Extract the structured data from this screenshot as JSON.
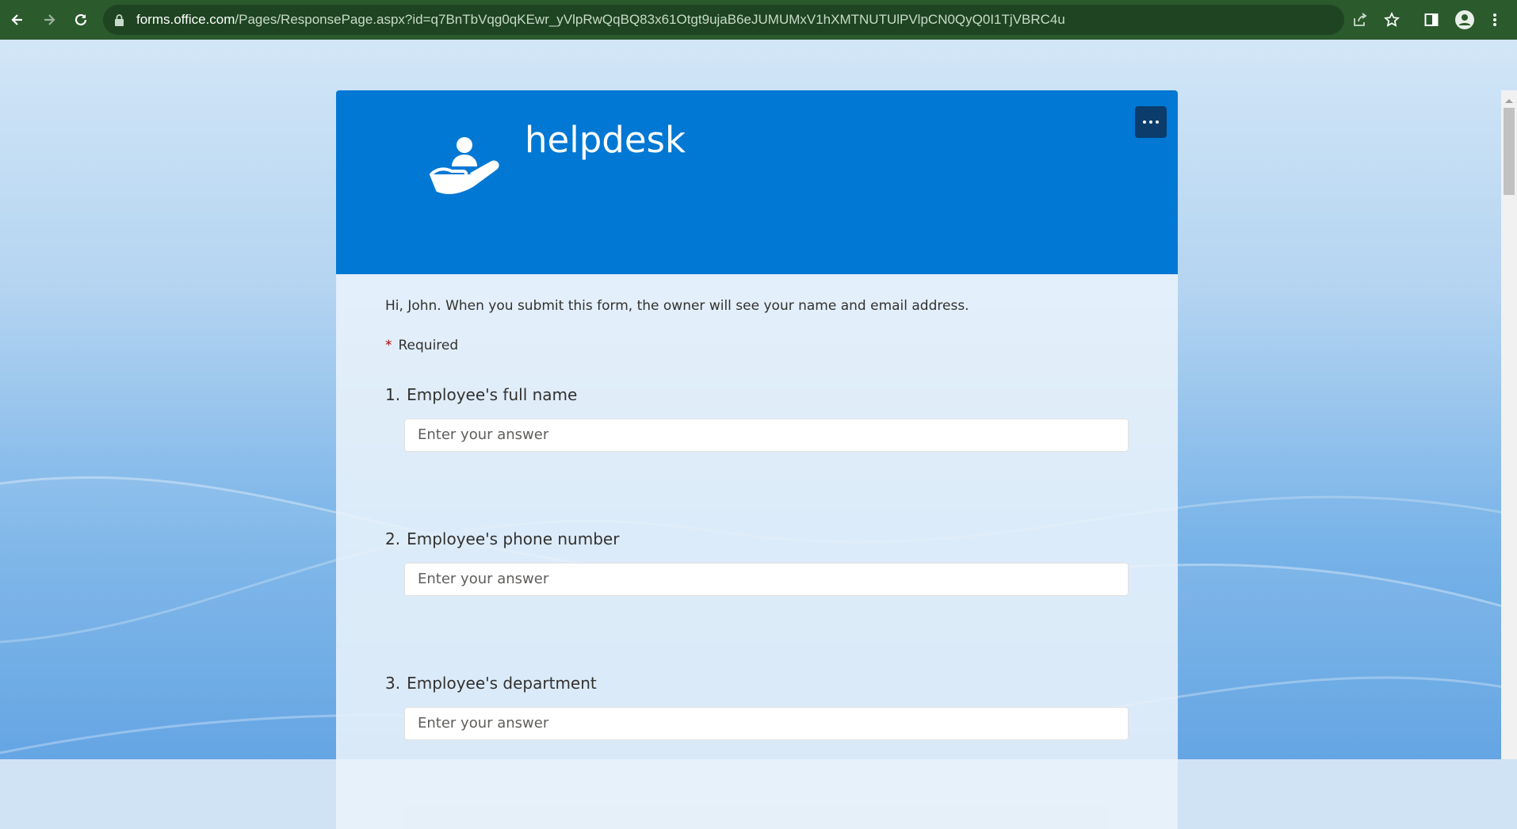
{
  "browser": {
    "url_host": "forms.office.com",
    "url_path": "/Pages/ResponsePage.aspx?id=q7BnTbVqg0qKEwr_yVlpRwQqBQ83x61Otgt9ujaB6eJUMUMxV1hXMTNUTUlPVlpCN0QyQ0I1TjVBRC4u",
    "icons": [
      "back-icon",
      "forward-icon",
      "reload-icon",
      "lock-icon",
      "share-icon",
      "star-icon",
      "sidepanel-icon",
      "profile-icon",
      "menu-icon"
    ]
  },
  "form": {
    "title": "helpdesk",
    "intro": "Hi, John. When you submit this form, the owner will see your name and email address.",
    "required_star": "*",
    "required_label": "Required",
    "questions": [
      {
        "number": "1.",
        "label": "Employee's full name",
        "placeholder": "Enter your answer"
      },
      {
        "number": "2.",
        "label": "Employee's phone number",
        "placeholder": "Enter your answer"
      },
      {
        "number": "3.",
        "label": "Employee's department",
        "placeholder": "Enter your answer"
      }
    ]
  },
  "colors": {
    "toolbar": "#2b5a2d",
    "banner": "#0078d4",
    "more_button": "#0b3c6c"
  }
}
